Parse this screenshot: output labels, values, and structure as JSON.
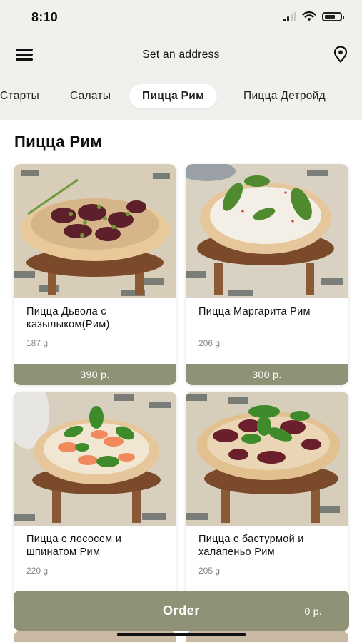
{
  "status_bar": {
    "time": "8:10"
  },
  "header": {
    "address": "Set an address"
  },
  "categories": [
    {
      "label": "Старты"
    },
    {
      "label": "Салаты"
    },
    {
      "label": "Пицца Рим",
      "active": true
    },
    {
      "label": "Пицца Детройд"
    }
  ],
  "section": {
    "title": "Пицца Рим"
  },
  "products": [
    {
      "name": "Пицца Дьвола  с казылыком(Рим)",
      "weight": "187 g",
      "price": "390 р."
    },
    {
      "name": "Пицца Маргарита Рим",
      "weight": "206 g",
      "price": "300 р."
    },
    {
      "name": "Пицца с  лососем и шпинатом Рим",
      "weight": "220 g",
      "price": ""
    },
    {
      "name": "Пицца с бастурмой и халапеньо Рим",
      "weight": "205 g",
      "price": ""
    }
  ],
  "order": {
    "label": "Order",
    "total": "0 р."
  },
  "icons": {
    "menu": "hamburger-menu-icon",
    "location": "map-pin-icon",
    "signal": "cellular-signal-icon",
    "wifi": "wifi-icon",
    "battery": "battery-icon"
  },
  "colors": {
    "accent": "#909278",
    "header_bg": "#f2f0ec",
    "active_tab_bg": "#ffffff"
  }
}
